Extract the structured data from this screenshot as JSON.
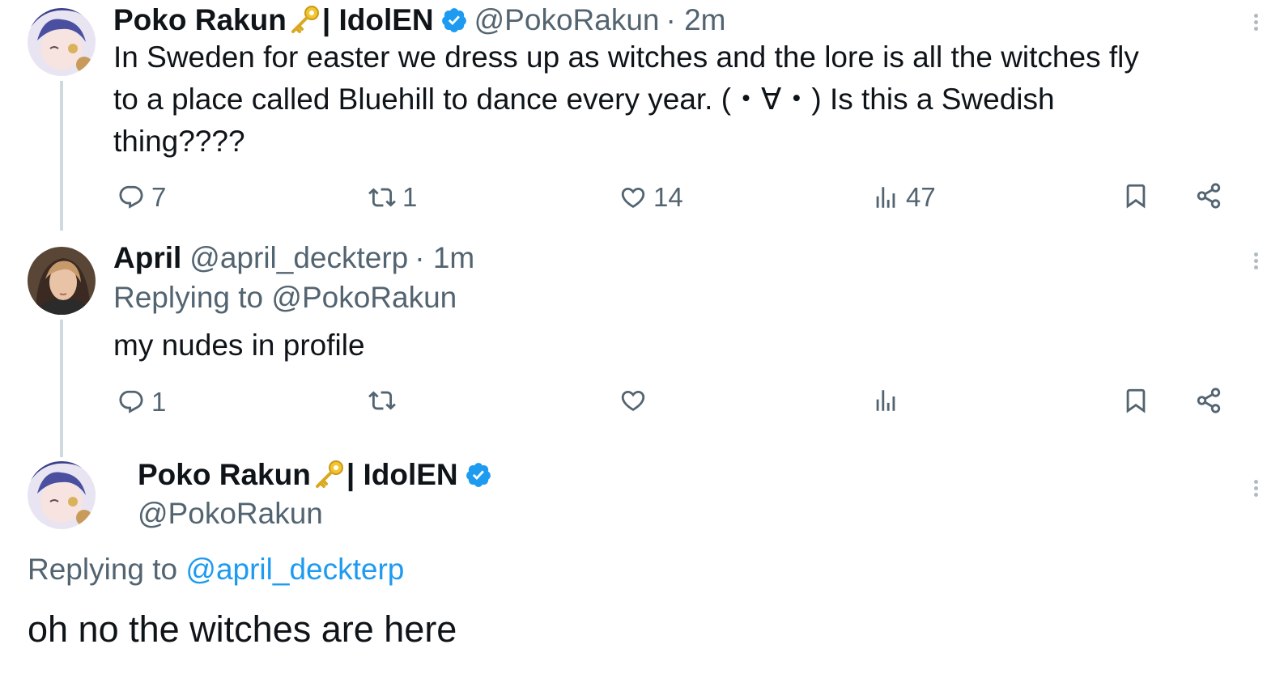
{
  "tweets": [
    {
      "display_name": "Poko Rakun",
      "name_suffix": "| IdolEN",
      "handle": "@PokoRakun",
      "time": "· 2m",
      "text_lines": [
        "In Sweden for easter we dress up as witches and the lore is all the witches fly",
        "to a place called Bluehill to dance every year. (・∀・) Is this a Swedish",
        "thing????"
      ],
      "replies": "7",
      "retweets": "1",
      "likes": "14",
      "views": "47"
    },
    {
      "display_name": "April",
      "handle": "@april_deckterp",
      "time": "· 1m",
      "replying_to": "Replying to @PokoRakun",
      "text": "my nudes in profile",
      "replies": "1",
      "retweets": "",
      "likes": "",
      "views": ""
    }
  ],
  "reply": {
    "display_name": "Poko Rakun",
    "name_suffix": "| IdolEN",
    "handle": "@PokoRakun",
    "replying_prefix": "Replying to",
    "replying_handle": "@april_deckterp",
    "text": "oh no the witches are here"
  },
  "colors": {
    "accent": "#1d9bf0",
    "secondary_text": "#536471",
    "primary_text": "#0f1419",
    "thread_line": "#cfd9de"
  },
  "icons": [
    "reply-icon",
    "retweet-icon",
    "like-icon",
    "views-icon",
    "bookmark-icon",
    "share-icon",
    "verified-icon",
    "key-emoji",
    "more-icon"
  ]
}
